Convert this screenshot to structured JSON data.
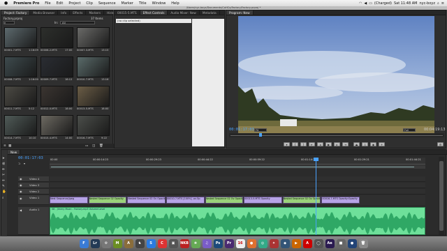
{
  "menubar": {
    "apple": "",
    "app_name": "Premiere Pro",
    "items": [
      "File",
      "Edit",
      "Project",
      "Clip",
      "Sequence",
      "Marker",
      "Title",
      "Window",
      "Help"
    ],
    "battery": "(Charged)",
    "clock": "Sat 11:48 AM",
    "user": "nyc-boyz"
  },
  "window_title": "/Users/nyc-boyz/Documents/CoHCo/Factory/Factory.prproj *",
  "project": {
    "tabs": [
      "Project: Factory",
      "Media Browser",
      "Info",
      "Effects",
      "Markers",
      "History"
    ],
    "name": "Factory.prproj",
    "item_count": "37 Items",
    "in_label": "In:",
    "in_value": "All",
    "clips": [
      {
        "name": "00001-7.MTS",
        "dur": "1:16:09"
      },
      {
        "name": "00006-2.MTS",
        "dur": "17:00"
      },
      {
        "name": "00007-3.MTS",
        "dur": "13:15"
      },
      {
        "name": "00008-7.MTS",
        "dur": "1:16:00"
      },
      {
        "name": "00009-7.MTS",
        "dur": "18:12"
      },
      {
        "name": "00010-7.MTS",
        "dur": "13:16"
      },
      {
        "name": "00011-7.MTS",
        "dur": "5:12"
      },
      {
        "name": "00012-0.MTS",
        "dur": "18:00"
      },
      {
        "name": "00013-5.MTS",
        "dur": "18:00"
      },
      {
        "name": "00014-7.MTS",
        "dur": "14:10"
      },
      {
        "name": "00015-4.MTS",
        "dur": "14:00"
      },
      {
        "name": "00016-7.MTS",
        "dur": "9:22"
      }
    ]
  },
  "source": {
    "tabs": [
      "00015-5.MTS",
      "Effect Controls",
      "Audio Mixer: New",
      "Metadata"
    ],
    "clip_select": "(no clip selected)"
  },
  "program": {
    "tab": "Program: New",
    "timecode": "00:01:17:03",
    "zoom": "Fit",
    "quality": "Full",
    "duration": "00:04:19:13"
  },
  "timeline": {
    "tab": "New",
    "timecode": "00:01:17:03",
    "ruler": [
      "00:00",
      "00:00:14:23",
      "00:00:29:23",
      "00:00:44:22",
      "00:00:59:22",
      "00:01:14:22",
      "00:01:29:21",
      "00:01:44:21"
    ],
    "video_tracks": [
      "Video 4",
      "Video 3",
      "Video 2",
      "Video 1"
    ],
    "audio_tracks": [
      "Audio 1"
    ],
    "v1_clips": [
      {
        "label": "Nest Sequence/jpeg",
        "color": "purple"
      },
      {
        "label": "Nested Sequence 02 Opacity",
        "color": "green"
      },
      {
        "label": "Nested Sequence 02 Ov Opacity",
        "color": "purple"
      },
      {
        "label": "00010-7.MTS [100%] .ov.Op",
        "color": "purple"
      },
      {
        "label": "Nested Sequence 02 Ov Opacity",
        "color": "green"
      },
      {
        "label": "00013-5.MTS Opacity",
        "color": "purple"
      },
      {
        "label": "Nested Sequence 02 Ov Opacity",
        "color": "green"
      },
      {
        "label": "00016-7.MTS Opacity:Opacity",
        "color": "purple"
      }
    ],
    "audio_clip": "08 - Jimmy Moan - Factory.mp3 Volume:Level"
  },
  "dock": {
    "icons": [
      {
        "name": "finder-icon",
        "label": "F",
        "color": "#3a7bd5"
      },
      {
        "name": "lightroom-icon",
        "label": "Lr",
        "color": "#233a55"
      },
      {
        "name": "preferences-icon",
        "label": "⚙",
        "color": "#777"
      },
      {
        "name": "minecraft-icon",
        "label": "M",
        "color": "#6b8e23"
      },
      {
        "name": "app-icon",
        "label": "A",
        "color": "#8a6d3b"
      },
      {
        "name": "chess-icon",
        "label": "♞",
        "color": "#444"
      },
      {
        "name": "safari-icon",
        "label": "S",
        "color": "#2b7be0"
      },
      {
        "name": "chrome-icon",
        "label": "C",
        "color": "#d33"
      },
      {
        "name": "app2-icon",
        "label": "▣",
        "color": "#555"
      },
      {
        "name": "nkb-icon",
        "label": "NKB",
        "color": "#b22"
      },
      {
        "name": "photos-icon",
        "label": "❀",
        "color": "#6a5"
      },
      {
        "name": "itunes-icon",
        "label": "♫",
        "color": "#7a5cc7"
      },
      {
        "name": "photoshop-icon",
        "label": "Ps",
        "color": "#1c4a7a"
      },
      {
        "name": "premiere-icon",
        "label": "Pr",
        "color": "#4a2a70"
      },
      {
        "name": "calendar-icon",
        "label": "16",
        "color": "#eee"
      },
      {
        "name": "app3-icon",
        "label": "●",
        "color": "#e07030"
      },
      {
        "name": "app4-icon",
        "label": "◎",
        "color": "#3a8"
      },
      {
        "name": "app5-icon",
        "label": "✦",
        "color": "#a33"
      },
      {
        "name": "app6-icon",
        "label": "◆",
        "color": "#357"
      },
      {
        "name": "app7-icon",
        "label": "▶",
        "color": "#c60"
      },
      {
        "name": "acrobat-icon",
        "label": "A",
        "color": "#c00"
      },
      {
        "name": "app8-icon",
        "label": "◯",
        "color": "#555"
      },
      {
        "name": "after-effects-icon",
        "label": "Ae",
        "color": "#2a1a50"
      },
      {
        "name": "app9-icon",
        "label": "■",
        "color": "#666"
      },
      {
        "name": "app10-icon",
        "label": "●",
        "color": "#247"
      },
      {
        "name": "trash-icon",
        "label": "🗑",
        "color": "#888"
      }
    ]
  }
}
